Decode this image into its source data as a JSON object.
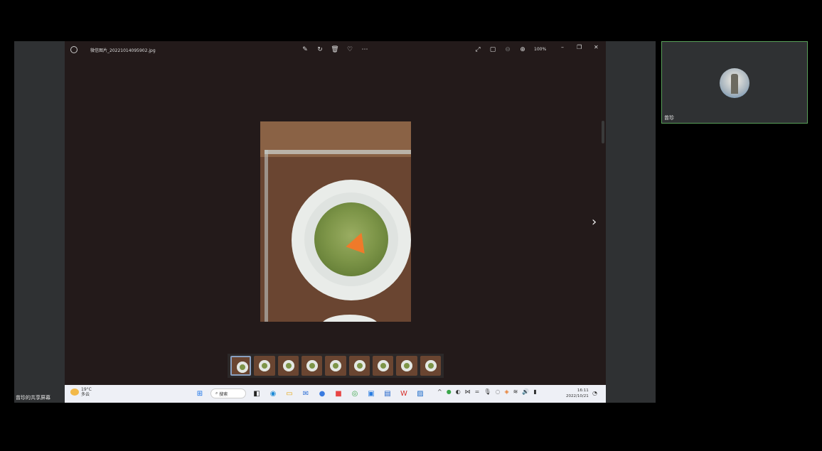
{
  "share": {
    "label": "曾珍的共享屏幕"
  },
  "photos": {
    "file_name": "微信图片_20221014095902.jpg",
    "zoom": "100%",
    "toolbar_icons": [
      "edit-icon",
      "rotate-icon",
      "delete-icon",
      "favorite-icon",
      "more-icon"
    ],
    "view_icons": [
      "fullscreen-icon",
      "fit-icon",
      "zoom-out-icon",
      "zoom-in-icon"
    ],
    "window_controls": [
      "minimize",
      "restore",
      "close"
    ],
    "filmstrip_count": 9,
    "selected_index": 0
  },
  "taskbar": {
    "temperature": "19°C",
    "condition": "多云",
    "search_label": "搜索",
    "time": "16:11",
    "date": "2022/10/21"
  },
  "participant": {
    "name": "曾珍",
    "border_color": "#5aa05a"
  }
}
